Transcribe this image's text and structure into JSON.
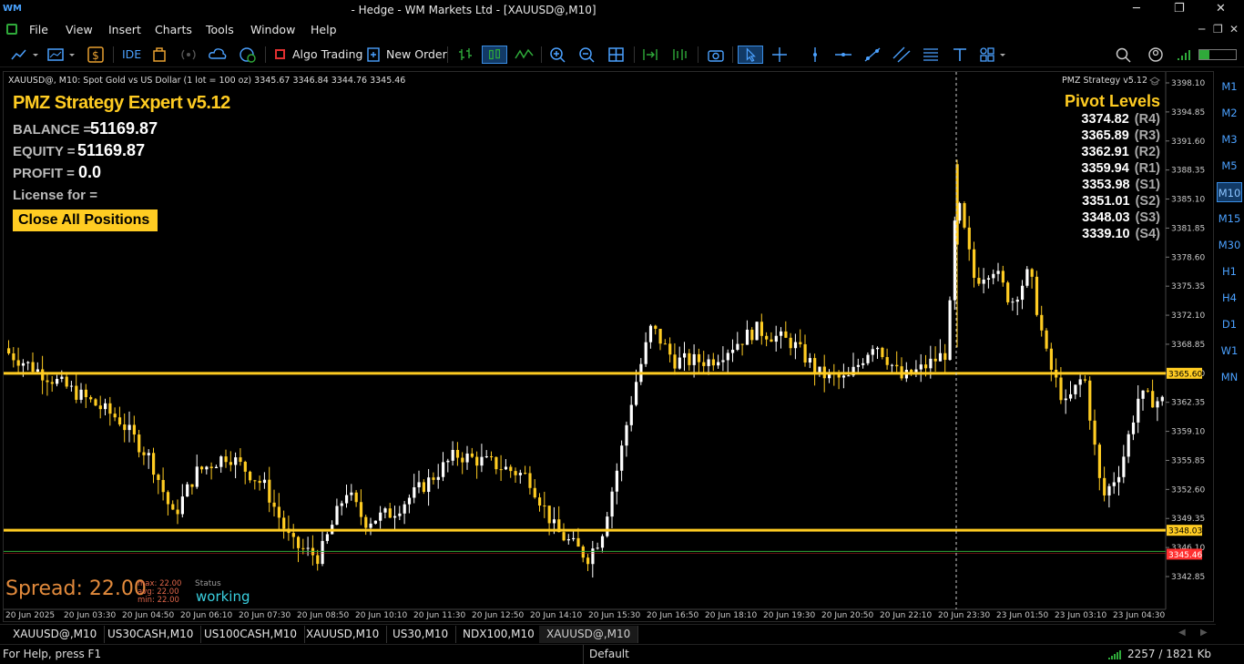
{
  "window": {
    "title": "- Hedge - WM Markets Ltd - [XAUUSD@,M10]",
    "logo": "WM",
    "minimize_icon": "─",
    "restore_icon": "❐",
    "close_icon": "✕"
  },
  "menu": {
    "items": [
      "File",
      "View",
      "Insert",
      "Charts",
      "Tools",
      "Window",
      "Help"
    ],
    "right_icons": [
      "─",
      "❐",
      "✕"
    ]
  },
  "toolbar": {
    "ide_label": "IDE",
    "algo_label": "Algo Trading",
    "new_order_label": "New Order"
  },
  "chart": {
    "header": "XAUUSD@, M10:  Spot Gold vs US Dollar (1 lot = 100 oz)  3345.67 3346.84 3344.76 3345.46",
    "strategy_label": "PMZ Strategy  v5.12",
    "price_axis": [
      "3398.10",
      "3394.85",
      "3391.60",
      "3388.35",
      "3385.10",
      "3381.85",
      "3378.60",
      "3375.35",
      "3372.10",
      "3368.85",
      "3365.60",
      "3362.35",
      "3359.10",
      "3355.85",
      "3352.60",
      "3349.35",
      "3346.10",
      "3342.85"
    ],
    "price_tags": {
      "upper": "3365.60",
      "mid": "3348.03",
      "bid": "3345.46"
    },
    "time_axis": [
      "20 Jun 2025",
      "20 Jun 03:30",
      "20 Jun 04:50",
      "20 Jun 06:10",
      "20 Jun 07:30",
      "20 Jun 08:50",
      "20 Jun 10:10",
      "20 Jun 11:30",
      "20 Jun 12:50",
      "20 Jun 14:10",
      "20 Jun 15:30",
      "20 Jun 16:50",
      "20 Jun 18:10",
      "20 Jun 19:30",
      "20 Jun 20:50",
      "20 Jun 22:10",
      "20 Jun 23:30",
      "23 Jun 01:50",
      "23 Jun 03:10",
      "23 Jun 04:30"
    ],
    "colors": {
      "bull": "#ffffff",
      "bear": "#ffcc22",
      "level": "#ffcc22",
      "bid_line": "#ff3030",
      "green_line": "#2faa3a"
    }
  },
  "expert": {
    "title": "PMZ Strategy Expert v5.12",
    "balance_label": "BALANCE =",
    "balance_value": "51169.87",
    "equity_label": "EQUITY =",
    "equity_value": "51169.87",
    "profit_label": "PROFIT =",
    "profit_value": "0.0",
    "license_label": "License for =",
    "close_button": "Close All Positions"
  },
  "pivots": {
    "title": "Pivot Levels",
    "levels": [
      {
        "value": "3374.82",
        "label": "(R4)"
      },
      {
        "value": "3365.89",
        "label": "(R3)"
      },
      {
        "value": "3362.91",
        "label": "(R2)"
      },
      {
        "value": "3359.94",
        "label": "(R1)"
      },
      {
        "value": "3353.98",
        "label": "(S1)"
      },
      {
        "value": "3351.01",
        "label": "(S2)"
      },
      {
        "value": "3348.03",
        "label": "(S3)"
      },
      {
        "value": "3339.10",
        "label": "(S4)"
      }
    ]
  },
  "spread": {
    "text": "Spread: 22.00",
    "max": "max: 22.00",
    "avg": "avg: 22.00",
    "min": "min: 22.00",
    "status_label": "Status",
    "status_value": "working"
  },
  "timeframes": {
    "items": [
      "M1",
      "M2",
      "M3",
      "M5",
      "M10",
      "M15",
      "M30",
      "H1",
      "H4",
      "D1",
      "W1",
      "MN"
    ],
    "active": "M10"
  },
  "tabs": {
    "items": [
      "XAUUSD@,M10",
      "US30CASH,M10",
      "US100CASH,M10",
      "XAUUSD,M10",
      "US30,M10",
      "NDX100,M10",
      "XAUUSD@,M10"
    ],
    "active_index": 6
  },
  "statusbar": {
    "help": "For Help, press F1",
    "profile": "Default",
    "traffic": "2257 / 1821 Kb"
  }
}
